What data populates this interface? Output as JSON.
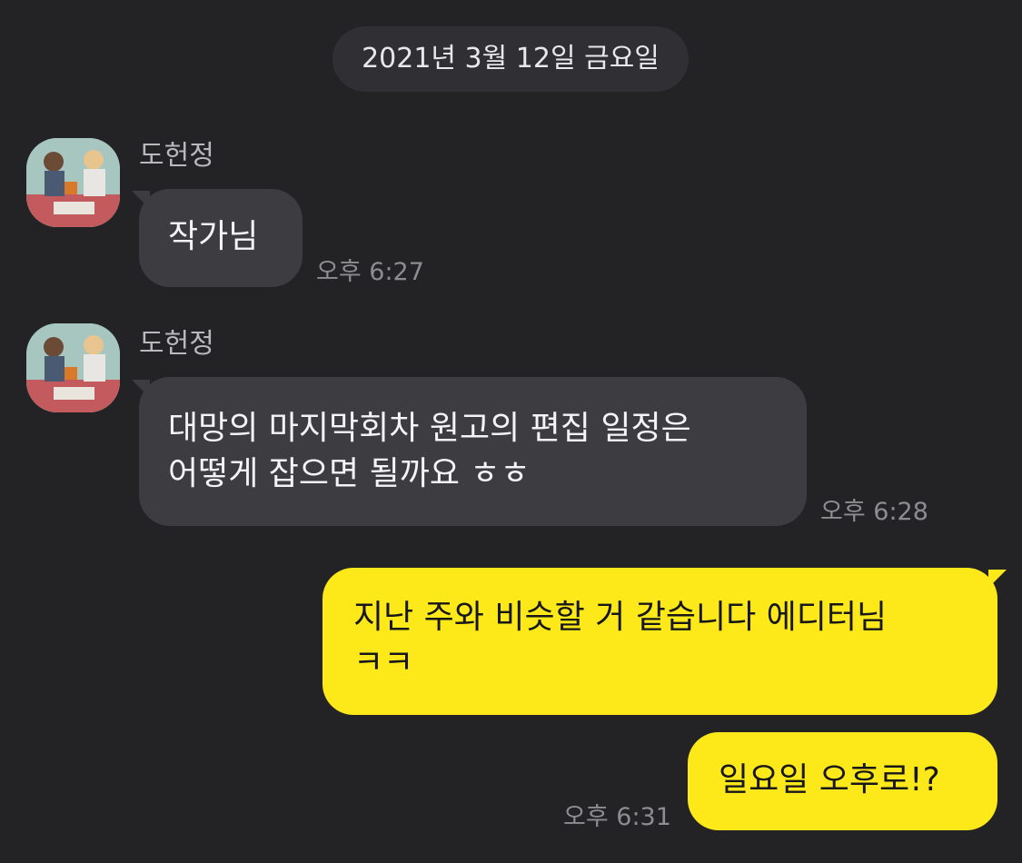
{
  "date_divider": "2021년 3월 12일 금요일",
  "messages": [
    {
      "sender": "도헌정",
      "lines": [
        "작가님"
      ],
      "time": "오후 6:27"
    },
    {
      "sender": "도헌정",
      "lines": [
        "대망의 마지막회차 원고의 편집 일정은",
        "어떻게 잡으면 될까요 ㅎㅎ"
      ],
      "time": "오후 6:28"
    },
    {
      "sender": "",
      "lines": [
        "지난 주와 비슷할 거 같습니다 에디터님",
        "ㅋㅋ"
      ],
      "time": ""
    },
    {
      "sender": "",
      "lines": [
        "일요일 오후로!?"
      ],
      "time": "오후 6:31"
    }
  ],
  "colors": {
    "background": "#232326",
    "incoming_bubble": "#3d3d41",
    "outgoing_bubble": "#fde81a",
    "timestamp": "#8d8d91"
  },
  "icons": {
    "avatar": "profile-photo-two-people-reading"
  }
}
